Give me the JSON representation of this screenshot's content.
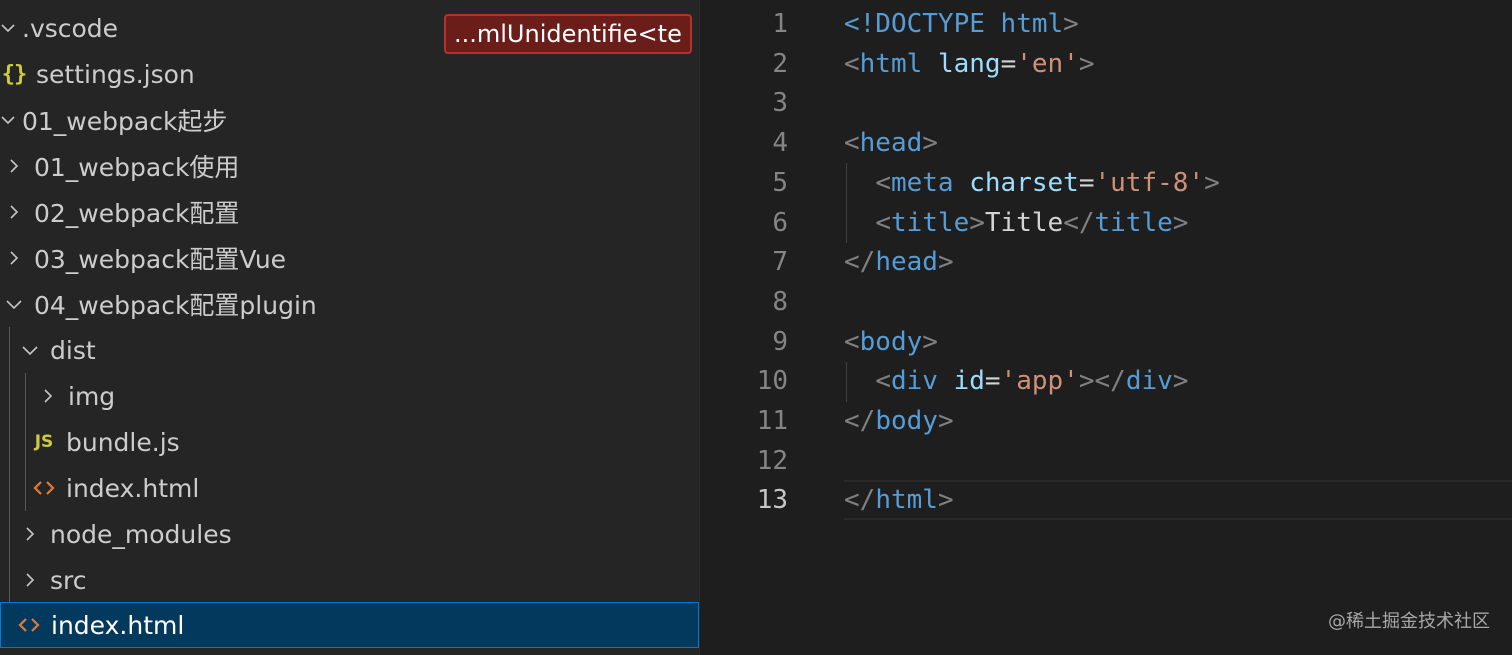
{
  "explorer": {
    "items": [
      {
        "label": ".vscode",
        "kind": "folder",
        "expanded": true
      },
      {
        "label": "settings.json",
        "kind": "json",
        "icon": "{}"
      },
      {
        "label": "01_webpack起步",
        "kind": "folder",
        "expanded": true
      },
      {
        "label": "01_webpack使用",
        "kind": "folder",
        "expanded": false
      },
      {
        "label": "02_webpack配置",
        "kind": "folder",
        "expanded": false
      },
      {
        "label": "03_webpack配置Vue",
        "kind": "folder",
        "expanded": false
      },
      {
        "label": "04_webpack配置plugin",
        "kind": "folder",
        "expanded": true
      },
      {
        "label": "dist",
        "kind": "folder",
        "expanded": true
      },
      {
        "label": "img",
        "kind": "folder",
        "expanded": false
      },
      {
        "label": "bundle.js",
        "kind": "js",
        "icon": "JS"
      },
      {
        "label": "index.html",
        "kind": "html",
        "icon": "<>"
      },
      {
        "label": "node_modules",
        "kind": "folder",
        "expanded": false
      },
      {
        "label": "src",
        "kind": "folder",
        "expanded": false
      },
      {
        "label": "index.html",
        "kind": "html",
        "icon": "<>",
        "selected": true
      }
    ],
    "problem_badge": "...mlUnidentifie<te"
  },
  "editor": {
    "active_line": 13,
    "lines": [
      {
        "number": "1",
        "tokens": [
          {
            "t": "<!DOCTYPE ",
            "c": "tag"
          },
          {
            "t": "html",
            "c": "tag"
          },
          {
            "t": ">",
            "c": "punct"
          }
        ]
      },
      {
        "number": "2",
        "tokens": [
          {
            "t": "<",
            "c": "punct"
          },
          {
            "t": "html",
            "c": "tag"
          },
          {
            "t": " ",
            "c": "text"
          },
          {
            "t": "lang",
            "c": "attr"
          },
          {
            "t": "=",
            "c": "eq"
          },
          {
            "t": "'en'",
            "c": "str"
          },
          {
            "t": ">",
            "c": "punct"
          }
        ]
      },
      {
        "number": "3",
        "tokens": []
      },
      {
        "number": "4",
        "tokens": [
          {
            "t": "<",
            "c": "punct"
          },
          {
            "t": "head",
            "c": "tag"
          },
          {
            "t": ">",
            "c": "punct"
          }
        ]
      },
      {
        "number": "5",
        "tokens": [
          {
            "t": "  ",
            "c": "text"
          },
          {
            "t": "<",
            "c": "punct"
          },
          {
            "t": "meta",
            "c": "tag"
          },
          {
            "t": " ",
            "c": "text"
          },
          {
            "t": "charset",
            "c": "attr"
          },
          {
            "t": "=",
            "c": "eq"
          },
          {
            "t": "'utf-8'",
            "c": "str"
          },
          {
            "t": ">",
            "c": "punct"
          }
        ]
      },
      {
        "number": "6",
        "tokens": [
          {
            "t": "  ",
            "c": "text"
          },
          {
            "t": "<",
            "c": "punct"
          },
          {
            "t": "title",
            "c": "tag"
          },
          {
            "t": ">",
            "c": "punct"
          },
          {
            "t": "Title",
            "c": "text"
          },
          {
            "t": "</",
            "c": "punct"
          },
          {
            "t": "title",
            "c": "tag"
          },
          {
            "t": ">",
            "c": "punct"
          }
        ]
      },
      {
        "number": "7",
        "tokens": [
          {
            "t": "</",
            "c": "punct"
          },
          {
            "t": "head",
            "c": "tag"
          },
          {
            "t": ">",
            "c": "punct"
          }
        ]
      },
      {
        "number": "8",
        "tokens": []
      },
      {
        "number": "9",
        "tokens": [
          {
            "t": "<",
            "c": "punct"
          },
          {
            "t": "body",
            "c": "tag"
          },
          {
            "t": ">",
            "c": "punct"
          }
        ]
      },
      {
        "number": "10",
        "tokens": [
          {
            "t": "  ",
            "c": "text"
          },
          {
            "t": "<",
            "c": "punct"
          },
          {
            "t": "div",
            "c": "tag"
          },
          {
            "t": " ",
            "c": "text"
          },
          {
            "t": "id",
            "c": "attr"
          },
          {
            "t": "=",
            "c": "eq"
          },
          {
            "t": "'app'",
            "c": "str"
          },
          {
            "t": "></",
            "c": "punct"
          },
          {
            "t": "div",
            "c": "tag"
          },
          {
            "t": ">",
            "c": "punct"
          }
        ]
      },
      {
        "number": "11",
        "tokens": [
          {
            "t": "</",
            "c": "punct"
          },
          {
            "t": "body",
            "c": "tag"
          },
          {
            "t": ">",
            "c": "punct"
          }
        ]
      },
      {
        "number": "12",
        "tokens": []
      },
      {
        "number": "13",
        "tokens": [
          {
            "t": "</",
            "c": "punct"
          },
          {
            "t": "html",
            "c": "tag"
          },
          {
            "t": ">",
            "c": "punct"
          }
        ]
      }
    ]
  },
  "watermark": "@稀土掘金技术社区",
  "colors": {
    "sidebar_bg": "#252526",
    "editor_bg": "#1e1e1e",
    "selection_bg": "#04395e",
    "selection_border": "#0078d4",
    "tag": "#569cd6",
    "attr": "#9cdcfe",
    "string": "#ce9178",
    "punct": "#808080"
  }
}
